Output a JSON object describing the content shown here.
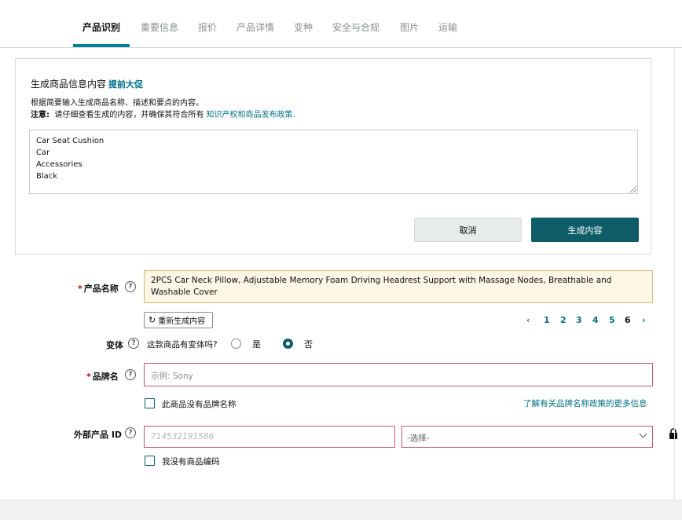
{
  "tabs": [
    {
      "label": "产品识别",
      "active": true
    },
    {
      "label": "重要信息"
    },
    {
      "label": "报价"
    },
    {
      "label": "产品详情"
    },
    {
      "label": "变种"
    },
    {
      "label": "安全与合规"
    },
    {
      "label": "图片"
    },
    {
      "label": "运输"
    }
  ],
  "generate_panel": {
    "title": "生成商品信息内容",
    "title_link": "提前大促",
    "description": "根据简要输入生成商品名称、描述和要点的内容。",
    "note_label": "注意:",
    "note_text": "请仔细查看生成的内容，并确保其符合所有",
    "note_link": "知识产权和商品发布政策.",
    "keywords": [
      "Car Seat Cushion",
      "Car",
      "Accessories",
      "Black"
    ],
    "cancel_label": "取消",
    "generate_label": "生成内容"
  },
  "product_name": {
    "label": "产品名称",
    "value": "2PCS Car Neck Pillow, Adjustable Memory Foam Driving Headrest Support with Massage Nodes, Breathable and Washable Cover",
    "regenerate_label": "重新生成内容"
  },
  "pagination": {
    "pages": [
      "1",
      "2",
      "3",
      "4",
      "5",
      "6"
    ],
    "current": "6"
  },
  "variant": {
    "label": "变体",
    "question": "这款商品有变体吗?",
    "yes_label": "是",
    "no_label": "否",
    "selected": "否"
  },
  "brand": {
    "label": "品牌名",
    "placeholder": "示例:  Sony",
    "no_brand_label": "此商品没有品牌名称",
    "policy_link": "了解有关品牌名称政策的更多信息"
  },
  "external_id": {
    "label": "外部产品 ID",
    "placeholder": "714532191586",
    "select_placeholder": "-选择-",
    "no_code_label": "我没有商品编码"
  },
  "colors": {
    "accent": "#008296",
    "primary_button": "#0f5c69",
    "error_border": "#c7547a",
    "link": "#007185"
  }
}
